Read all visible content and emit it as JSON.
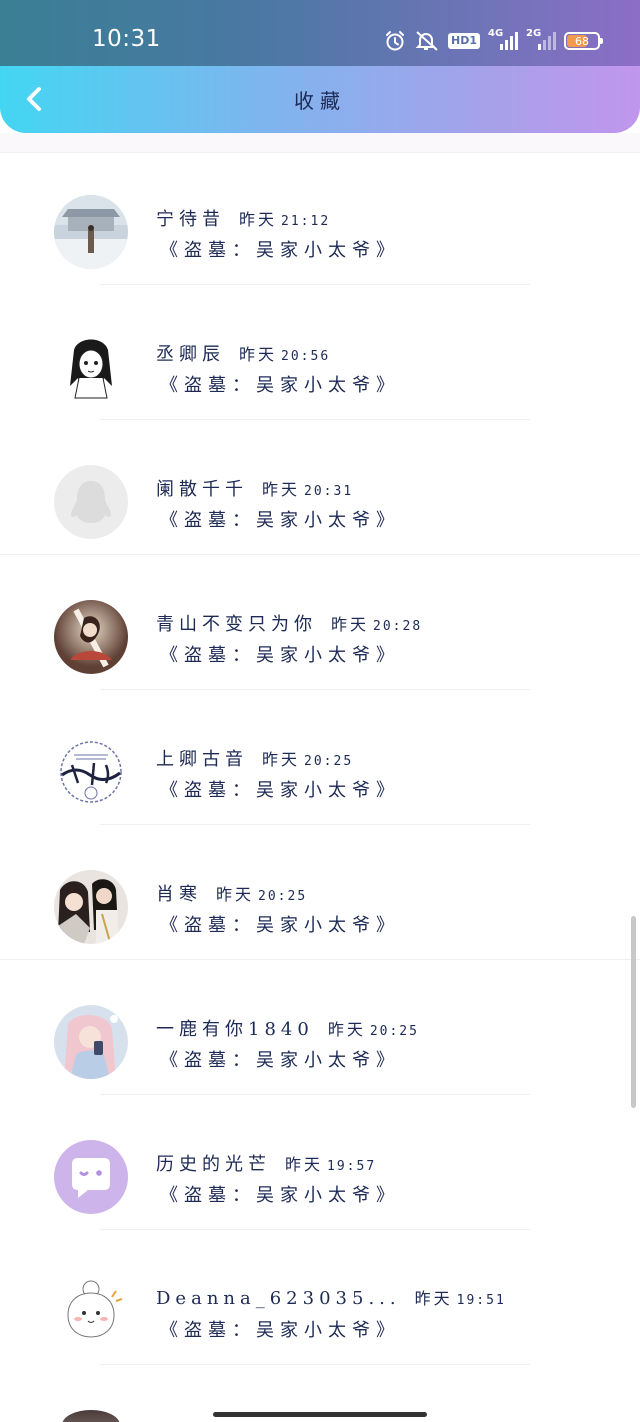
{
  "status_bar": {
    "time": "10:31",
    "icons": [
      "alarm-icon",
      "mute-icon",
      "hd-icon",
      "4g-signal-icon",
      "2g-signal-icon",
      "battery-icon"
    ],
    "hd_label": "HD1",
    "network_1": "4G",
    "network_2": "2G",
    "battery_level": "68",
    "battery_fraction": 0.68
  },
  "header": {
    "back_icon": "chevron-left-icon",
    "title": "收藏",
    "gradient_colors": [
      "#43d6f2",
      "#c196ec"
    ]
  },
  "favorites": [
    {
      "username": "宁待昔",
      "date": "昨天",
      "time": "21:12",
      "content": "《盗墓：吴家小太爷》",
      "avatar": "snow-scene-avatar"
    },
    {
      "username": "丞卿辰",
      "date": "昨天",
      "time": "20:56",
      "content": "《盗墓：吴家小太爷》",
      "avatar": "manga-girl-avatar"
    },
    {
      "username": "阑散千千",
      "date": "昨天",
      "time": "20:31",
      "content": "《盗墓：吴家小太爷》",
      "avatar": "default-penguin-avatar"
    },
    {
      "username": "青山不变只为你",
      "date": "昨天",
      "time": "20:28",
      "content": "《盗墓：吴家小太爷》",
      "avatar": "ancient-beauty-avatar"
    },
    {
      "username": "上卿古音",
      "date": "昨天",
      "time": "20:25",
      "content": "《盗墓：吴家小太爷》",
      "avatar": "calligraphy-seal-avatar"
    },
    {
      "username": "肖寒",
      "date": "昨天",
      "time": "20:25",
      "content": "《盗墓：吴家小太爷》",
      "avatar": "hanfu-couple-avatar"
    },
    {
      "username": "一鹿有你1840",
      "date": "昨天",
      "time": "20:25",
      "content": "《盗墓：吴家小太爷》",
      "avatar": "phone-girl-avatar"
    },
    {
      "username": "历史的光芒",
      "date": "昨天",
      "time": "19:57",
      "content": "《盗墓：吴家小太爷》",
      "avatar": "chat-bubble-avatar"
    },
    {
      "username": "Deanna_623035...",
      "date": "昨天",
      "time": "19:51",
      "content": "《盗墓：吴家小太爷》",
      "avatar": "cartoon-bunny-avatar"
    }
  ]
}
